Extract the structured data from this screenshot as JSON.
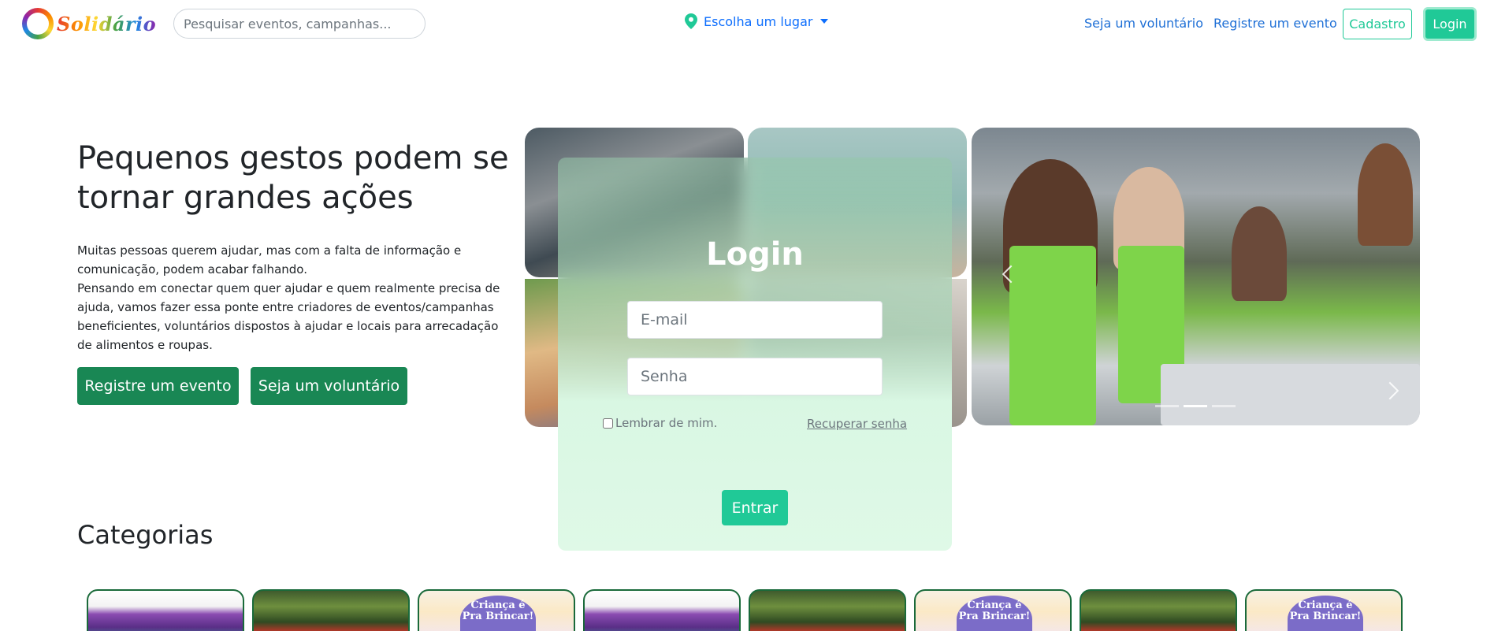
{
  "navbar": {
    "logo_text": "Solidário",
    "search_placeholder": "Pesquisar eventos, campanhas...",
    "location_label": "Escolha um lugar",
    "links": {
      "volunteer": "Seja um voluntário",
      "register_event": "Registre um evento"
    },
    "signup_label": "Cadastro",
    "login_label": "Login"
  },
  "hero": {
    "title": "Pequenos gestos podem se tornar grandes ações",
    "paragraph_1": "Muitas pessoas querem ajudar, mas com a falta de informação e comunicação, podem acabar falhando.",
    "paragraph_2": "Pensando em conectar quem quer ajudar e quem realmente precisa de ajuda, vamos fazer essa ponte entre criadores de eventos/campanhas beneficientes, voluntários dispostos à ajudar e locais para arrecadação de alimentos e roupas.",
    "btn_register": "Registre um evento",
    "btn_volunteer": "Seja um voluntário"
  },
  "login_modal": {
    "title": "Login",
    "email_placeholder": "E-mail",
    "password_placeholder": "Senha",
    "remember_label": "Lembrar de mim.",
    "recover_label": "Recuperar senha",
    "submit_label": "Entrar"
  },
  "categories": {
    "title": "Categorias",
    "kids_badge_text": "Criança é Pra Brincar!",
    "cards": [
      "clothes",
      "forest",
      "kids",
      "clothes",
      "forest",
      "kids",
      "forest",
      "kids"
    ]
  },
  "colors": {
    "primary_green": "#198754",
    "accent_teal": "#20c997",
    "link_blue": "#1e6fd6"
  },
  "icons": {
    "location": "map-pin-icon",
    "dropdown": "caret-down-icon"
  }
}
